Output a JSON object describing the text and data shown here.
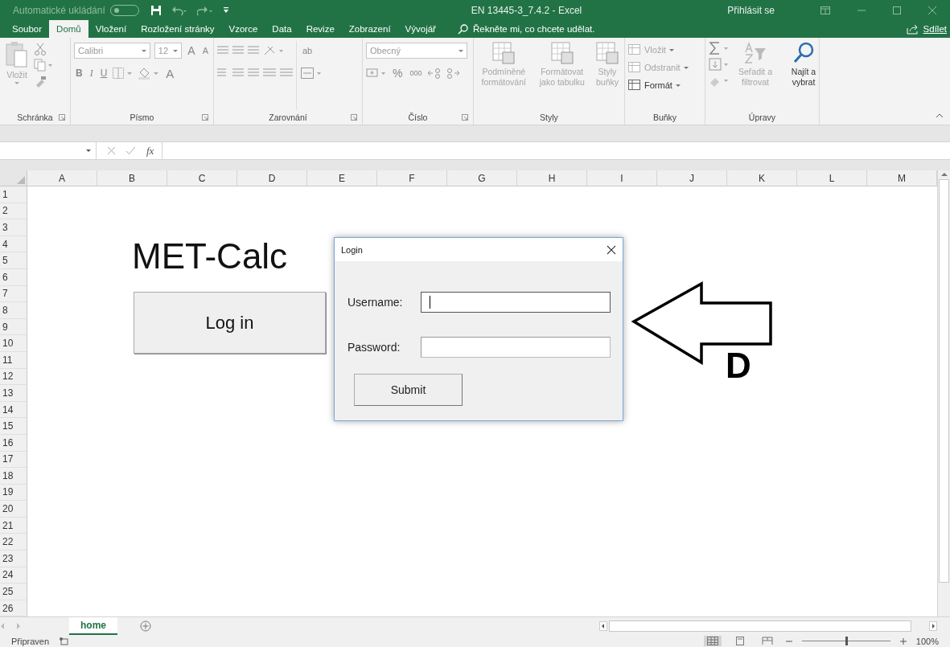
{
  "window": {
    "autosave_label": "Automatické ukládání",
    "autosave_on": false,
    "title": "EN 13445-3_7.4.2  -  Excel",
    "sign_in": "Přihlásit se"
  },
  "ribbon_tabs": [
    {
      "label": "Soubor",
      "selected": false
    },
    {
      "label": "Domů",
      "selected": true
    },
    {
      "label": "Vložení",
      "selected": false
    },
    {
      "label": "Rozložení stránky",
      "selected": false
    },
    {
      "label": "Vzorce",
      "selected": false
    },
    {
      "label": "Data",
      "selected": false
    },
    {
      "label": "Revize",
      "selected": false
    },
    {
      "label": "Zobrazení",
      "selected": false
    },
    {
      "label": "Vývojář",
      "selected": false
    }
  ],
  "tell_me": "Řekněte mi, co chcete udělat.",
  "share": "Sdílet",
  "ribbon": {
    "paste": {
      "label": "Vložit",
      "disabled": true
    },
    "font": "Calibri",
    "font_size": "12",
    "font_buttons": [
      "B",
      "I",
      "U"
    ],
    "font_color": "A",
    "grow_font": "A",
    "shrink_font": "A",
    "wrap": "ab",
    "number_format": "Obecný",
    "percent": "%",
    "thousands": "000",
    "styles": [
      {
        "label": "Podmíněné formátování",
        "disabled": true
      },
      {
        "label": "Formátovat jako tabulku",
        "disabled": true
      },
      {
        "label": "Styly buňky",
        "disabled": true
      }
    ],
    "cells": [
      {
        "label": "Vložit",
        "disabled": true
      },
      {
        "label": "Odstranit",
        "disabled": true
      },
      {
        "label": "Formát",
        "disabled": false
      }
    ],
    "editing": [
      {
        "label": "Seřadit a filtrovat",
        "disabled": true
      },
      {
        "label": "Najít a vybrat",
        "disabled": false
      }
    ],
    "groups": [
      "Schránka",
      "Písmo",
      "Zarovnání",
      "Číslo",
      "Styly",
      "Buňky",
      "Úpravy"
    ]
  },
  "formula_bar": {
    "fx": "fx"
  },
  "columns": [
    "A",
    "B",
    "C",
    "D",
    "E",
    "F",
    "G",
    "H",
    "I",
    "J",
    "K",
    "L",
    "M"
  ],
  "rows": [
    "1",
    "2",
    "3",
    "4",
    "5",
    "6",
    "7",
    "8",
    "9",
    "10",
    "11",
    "12",
    "13",
    "14",
    "15",
    "16",
    "17",
    "18",
    "19",
    "20",
    "21",
    "22",
    "23",
    "24",
    "25",
    "26"
  ],
  "sheet": {
    "title": "MET-Calc",
    "button": "Log in",
    "annotation": "D"
  },
  "dialog": {
    "title": "Login",
    "fields": [
      {
        "label": "Username:",
        "focused": true
      },
      {
        "label": "Password:",
        "focused": false
      }
    ],
    "submit": "Submit"
  },
  "sheet_tabs": [
    {
      "label": "home",
      "selected": true
    }
  ],
  "status_bar": {
    "text": "Připraven",
    "views": [
      {
        "kind": "normal",
        "selected": true
      },
      {
        "kind": "layout",
        "selected": false
      },
      {
        "kind": "break",
        "selected": false
      }
    ],
    "zoom": {
      "level": 0.5
    },
    "zoom_text": "100%"
  }
}
